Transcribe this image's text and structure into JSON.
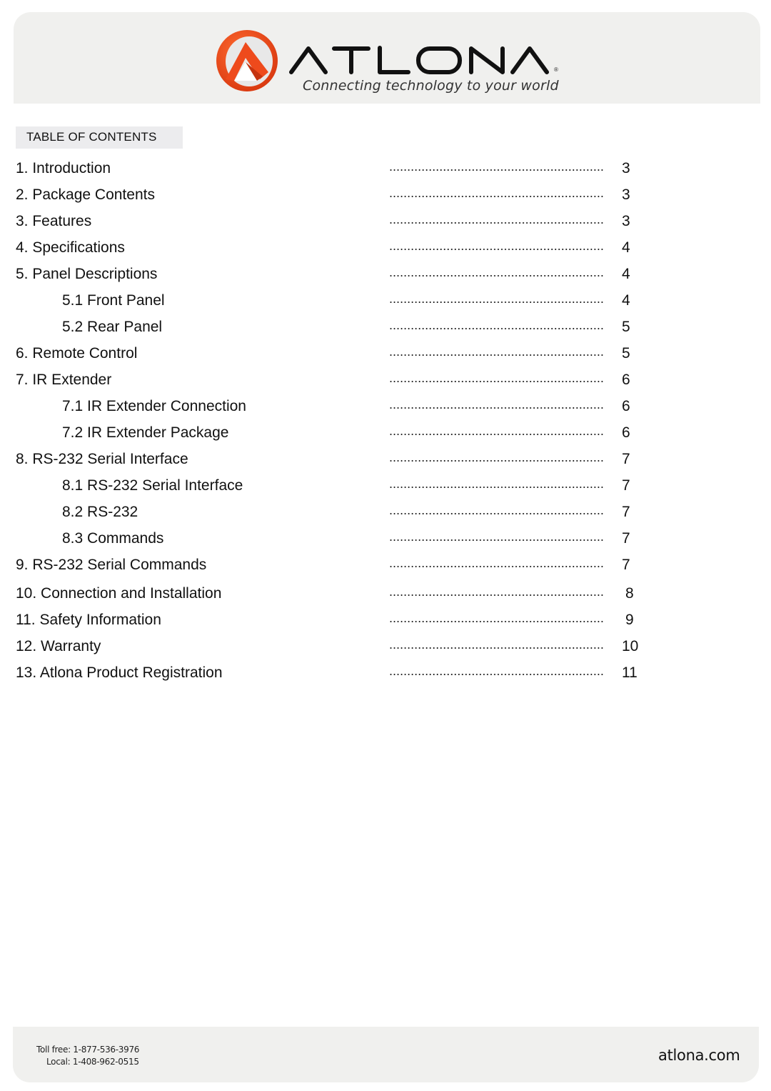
{
  "header": {
    "brand": "ATLONA",
    "tagline": "Connecting technology to your world",
    "registered_mark": "®",
    "brand_colors": {
      "orange": "#ee4a1c",
      "dark": "#111111"
    }
  },
  "toc": {
    "heading": "TABLE OF CONTENTS",
    "entries": [
      {
        "title": "1. Introduction",
        "page": "3",
        "level": 1
      },
      {
        "title": "2. Package Contents",
        "page": "3",
        "level": 1
      },
      {
        "title": "3. Features",
        "page": "3",
        "level": 1
      },
      {
        "title": "4. Specifications",
        "page": "4",
        "level": 1
      },
      {
        "title": "5. Panel Descriptions",
        "page": "4",
        "level": 1
      },
      {
        "title": "5.1 Front Panel",
        "page": "4",
        "level": 2
      },
      {
        "title": "5.2 Rear Panel",
        "page": "5",
        "level": 2
      },
      {
        "title": "6. Remote Control",
        "page": "5",
        "level": 1
      },
      {
        "title": "7. IR Extender",
        "page": "6",
        "level": 1
      },
      {
        "title": "7.1 IR Extender Connection",
        "page": "6",
        "level": 2
      },
      {
        "title": "7.2 IR Extender Package",
        "page": "6",
        "level": 2
      },
      {
        "title": "8. RS-232 Serial Interface",
        "page": "7",
        "level": 1
      },
      {
        "title": "8.1 RS-232 Serial Interface",
        "page": "7",
        "level": 2
      },
      {
        "title": "8.2 RS-232",
        "page": "7",
        "level": 2
      },
      {
        "title": "8.3 Commands",
        "page": "7",
        "level": 2
      },
      {
        "title": "9. RS-232 Serial Commands",
        "page": "7",
        "level": 1
      },
      {
        "title": "10. Connection and Installation",
        "page": "8",
        "level": 1
      },
      {
        "title": "11. Safety Information",
        "page": "9",
        "level": 1
      },
      {
        "title": "12. Warranty",
        "page": "10",
        "level": 1
      },
      {
        "title": "13. Atlona Product Registration",
        "page": "11",
        "level": 1
      }
    ]
  },
  "footer": {
    "toll_free_label": "Toll free:",
    "toll_free": "1-877-536-3976",
    "local_label": "Local:",
    "local": "1-408-962-0515",
    "website": "atlona.com"
  }
}
